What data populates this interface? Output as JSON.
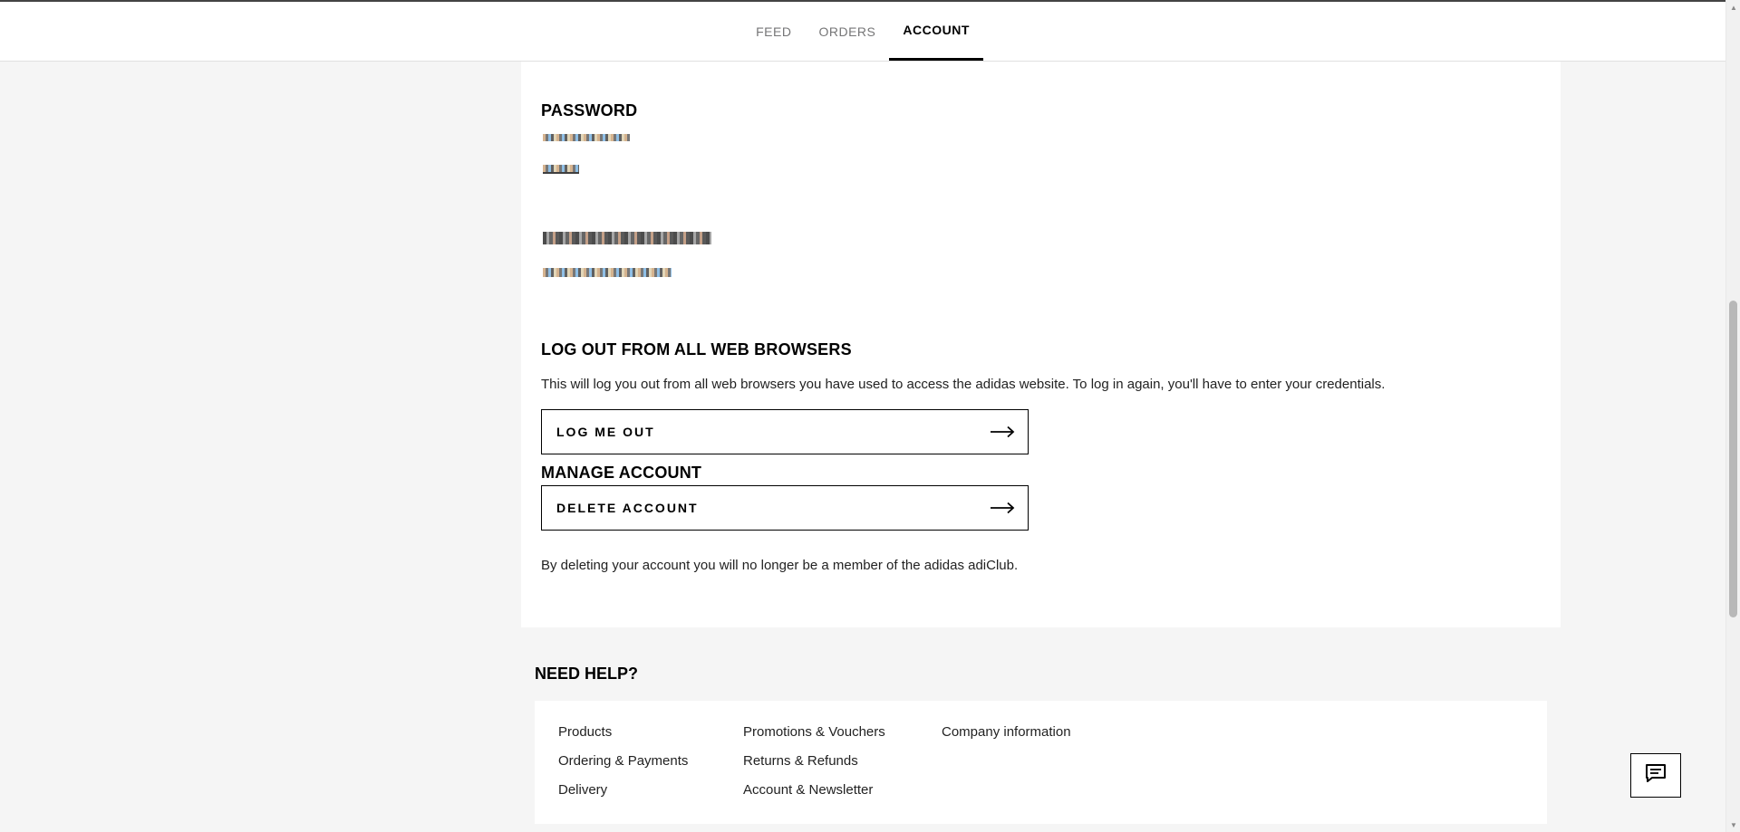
{
  "nav": {
    "tabs": [
      {
        "label": "FEED"
      },
      {
        "label": "ORDERS"
      },
      {
        "label": "ACCOUNT"
      }
    ],
    "active_tab": "ACCOUNT"
  },
  "password": {
    "title": "PASSWORD"
  },
  "logout_all": {
    "title": "LOG OUT FROM ALL WEB BROWSERS",
    "description": "This will log you out from all web browsers you have used to access the adidas website. To log in again, you'll have to enter your credentials.",
    "button_label": "LOG ME OUT"
  },
  "manage_account": {
    "title": "MANAGE ACCOUNT",
    "button_label": "DELETE ACCOUNT",
    "note": "By deleting your account you will no longer be a member of the adidas adiClub."
  },
  "help": {
    "title": "NEED HELP?",
    "columns": [
      [
        "Products",
        "Ordering & Payments",
        "Delivery"
      ],
      [
        "Promotions & Vouchers",
        "Returns & Refunds",
        "Account & Newsletter"
      ],
      [
        "Company information"
      ]
    ]
  },
  "icons": {
    "arrow": "arrow-right-icon",
    "chat": "chat-icon"
  }
}
